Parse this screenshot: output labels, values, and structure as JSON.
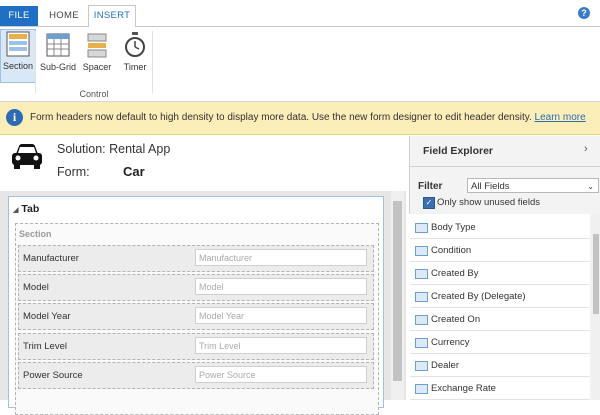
{
  "tabs": {
    "file": "FILE",
    "home": "HOME",
    "insert": "INSERT"
  },
  "help": "?",
  "ribbon": {
    "buttons": [
      {
        "label": "Section",
        "icon": "section-icon"
      },
      {
        "label": "Sub-Grid",
        "icon": "subgrid-icon"
      },
      {
        "label": "Spacer",
        "icon": "spacer-icon"
      },
      {
        "label": "Timer",
        "icon": "timer-icon"
      }
    ],
    "group_label": "Control"
  },
  "notice": {
    "icon": "i",
    "text": "Form headers now default to high density to display more data. Use the new form designer to edit header density.",
    "link": "Learn more"
  },
  "header": {
    "solution": "Solution: Rental App",
    "form_label": "Form:",
    "form_name": "Car"
  },
  "form": {
    "tab_label": "Tab",
    "section_label": "Section",
    "fields": [
      {
        "label": "Manufacturer",
        "placeholder": "Manufacturer"
      },
      {
        "label": "Model",
        "placeholder": "Model"
      },
      {
        "label": "Model Year",
        "placeholder": "Model Year"
      },
      {
        "label": "Trim Level",
        "placeholder": "Trim Level"
      },
      {
        "label": "Power Source",
        "placeholder": "Power Source"
      }
    ]
  },
  "field_explorer": {
    "title": "Field Explorer",
    "filter_label": "Filter",
    "filter_value": "All Fields",
    "checkbox_label": "Only show unused fields",
    "checkbox_checked": true,
    "items": [
      "Body Type",
      "Condition",
      "Created By",
      "Created By (Delegate)",
      "Created On",
      "Currency",
      "Dealer",
      "Exchange Rate"
    ]
  },
  "colors": {
    "accent": "#1f6fc5",
    "notice_bg": "#fbeeb8",
    "link": "#2b6cb0"
  }
}
